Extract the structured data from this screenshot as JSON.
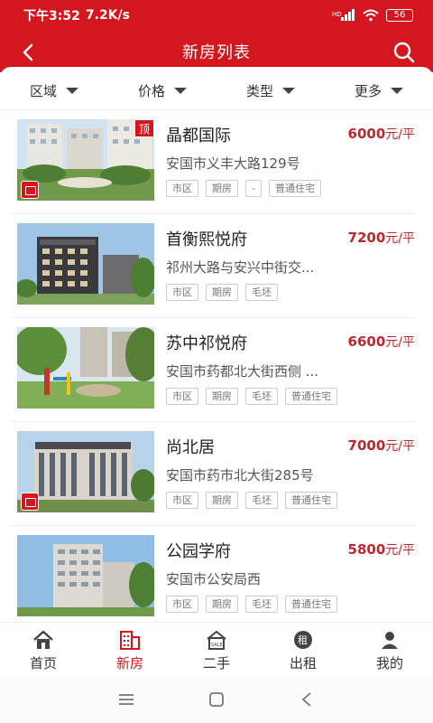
{
  "status_bar": {
    "time": "下午3:52",
    "net_speed": "7.2K/s",
    "signal_label": "HD",
    "battery": "56"
  },
  "header": {
    "title": "新房列表"
  },
  "filters": [
    {
      "label": "区域"
    },
    {
      "label": "价格"
    },
    {
      "label": "类型"
    },
    {
      "label": "更多"
    }
  ],
  "listings": [
    {
      "name": "晶都国际",
      "price": "6000",
      "unit": "元/平",
      "address": "安国市义丰大路129号",
      "tags": [
        "市区",
        "期房",
        "-",
        "普通住宅"
      ],
      "badge_top": "顶"
    },
    {
      "name": "首衡熙悦府",
      "price": "7200",
      "unit": "元/平",
      "address": "祁州大路与安兴中街交...",
      "tags": [
        "市区",
        "期房",
        "毛坯"
      ]
    },
    {
      "name": "苏中祁悦府",
      "price": "6600",
      "unit": "元/平",
      "address": "安国市药都北大街西侧 ...",
      "tags": [
        "市区",
        "期房",
        "毛坯",
        "普通住宅"
      ]
    },
    {
      "name": "尚北居",
      "price": "7000",
      "unit": "元/平",
      "address": "安国市药市北大街285号",
      "tags": [
        "市区",
        "期房",
        "毛坯",
        "普通住宅"
      ]
    },
    {
      "name": "公园学府",
      "price": "5800",
      "unit": "元/平",
      "address": "安国市公安局西",
      "tags": [
        "市区",
        "期房",
        "毛坯",
        "普通住宅"
      ]
    }
  ],
  "bottom_nav": [
    {
      "label": "首页",
      "icon": "home-icon"
    },
    {
      "label": "新房",
      "icon": "building-icon"
    },
    {
      "label": "二手",
      "icon": "sale-house-icon"
    },
    {
      "label": "出租",
      "icon": "rent-icon"
    },
    {
      "label": "我的",
      "icon": "user-icon"
    }
  ],
  "bottom_nav_icon_texts": {
    "sale": "SALE",
    "rent": "租"
  },
  "colors": {
    "brand_red": "#d4161e",
    "price_red": "#c0272d"
  }
}
